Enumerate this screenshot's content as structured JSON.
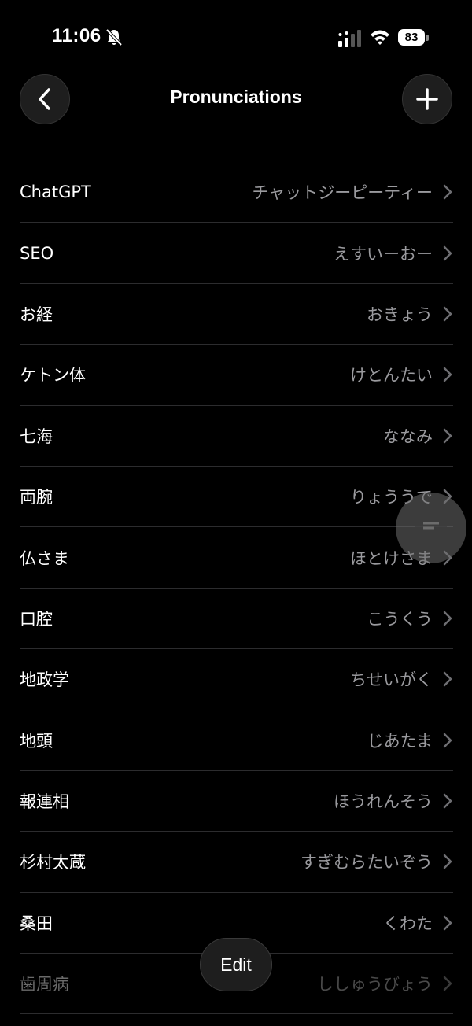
{
  "status_bar": {
    "time": "11:06",
    "battery": "83"
  },
  "header": {
    "title": "Pronunciations"
  },
  "pronunciations": [
    {
      "term": "ChatGPT",
      "reading": "チャットジーピーティー"
    },
    {
      "term": "SEO",
      "reading": "えすいーおー"
    },
    {
      "term": "お経",
      "reading": "おきょう"
    },
    {
      "term": "ケトン体",
      "reading": "けとんたい"
    },
    {
      "term": "七海",
      "reading": "ななみ"
    },
    {
      "term": "両腕",
      "reading": "りょううで"
    },
    {
      "term": "仏さま",
      "reading": "ほとけさま"
    },
    {
      "term": "口腔",
      "reading": "こうくう"
    },
    {
      "term": "地政学",
      "reading": "ちせいがく"
    },
    {
      "term": "地頭",
      "reading": "じあたま"
    },
    {
      "term": "報連相",
      "reading": "ほうれんそう"
    },
    {
      "term": "杉村太蔵",
      "reading": "すぎむらたいぞう"
    },
    {
      "term": "桑田",
      "reading": "くわた"
    },
    {
      "term": "歯周病",
      "reading": "ししゅうびょう"
    }
  ],
  "footer": {
    "edit_label": "Edit"
  },
  "icons": {
    "back": "chevron-left-icon",
    "add": "plus-icon",
    "row": "chevron-right-icon",
    "floating": "chat-bubble-icon"
  },
  "colors": {
    "background": "#000000",
    "secondary_text": "#9a9a9e",
    "separator": "#2c2c2e",
    "button_bg": "#1e1e1e"
  }
}
